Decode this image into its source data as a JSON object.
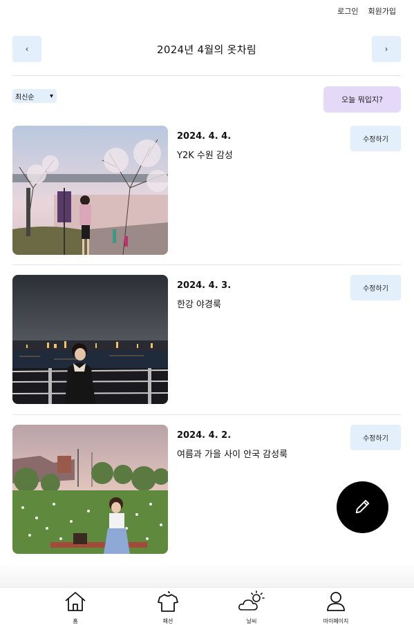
{
  "topnav": {
    "login": "로그인",
    "signup": "회원가입"
  },
  "header": {
    "prev": "‹",
    "next": "›",
    "title": "2024년 4월의 옷차림"
  },
  "controls": {
    "sort_value": "최신순",
    "sort_arrow": "▾",
    "what_wear": "오늘 뭐입지?"
  },
  "posts": [
    {
      "date": "2024. 4. 4.",
      "caption": "Y2K 수원 감성",
      "edit": "수정하기"
    },
    {
      "date": "2024. 4. 3.",
      "caption": "한강 야경룩",
      "edit": "수정하기"
    },
    {
      "date": "2024. 4. 2.",
      "caption": "여름과 가을 사이 안국 감성룩",
      "edit": "수정하기"
    }
  ],
  "bottom_nav": [
    {
      "label": "홈",
      "icon": "home-icon"
    },
    {
      "label": "패션",
      "icon": "shirt-icon"
    },
    {
      "label": "날씨",
      "icon": "weather-icon"
    },
    {
      "label": "마이페이지",
      "icon": "user-icon"
    }
  ]
}
